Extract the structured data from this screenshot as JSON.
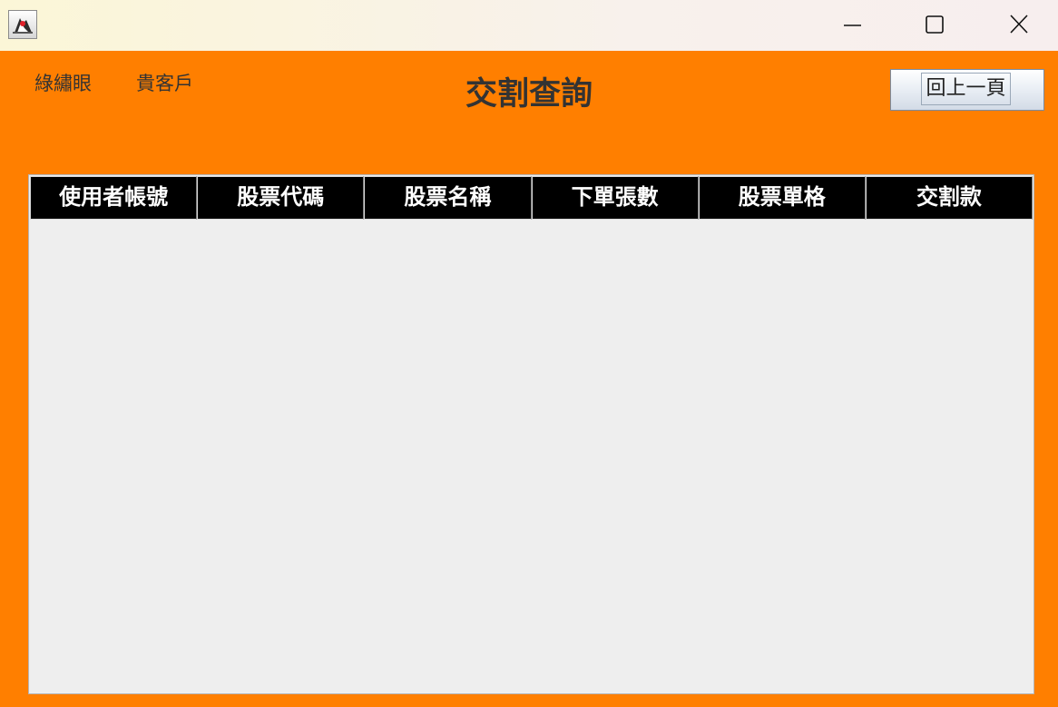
{
  "window": {
    "controls": {
      "minimize_icon": "minimize-icon",
      "maximize_icon": "maximize-icon",
      "close_icon": "close-icon"
    },
    "app_icon": "java-duke-icon"
  },
  "header": {
    "user_name": "綠繡眼",
    "user_suffix": "貴客戶",
    "title": "交割查詢",
    "back_label": "回上一頁"
  },
  "table": {
    "columns": [
      "使用者帳號",
      "股票代碼",
      "股票名稱",
      "下單張數",
      "股票單格",
      "交割款"
    ],
    "rows": []
  },
  "colors": {
    "background": "#FF7F00",
    "header_bg": "#000000",
    "header_text": "#FFFFFF",
    "table_body": "#EEEEEE",
    "label_text": "#333333"
  }
}
